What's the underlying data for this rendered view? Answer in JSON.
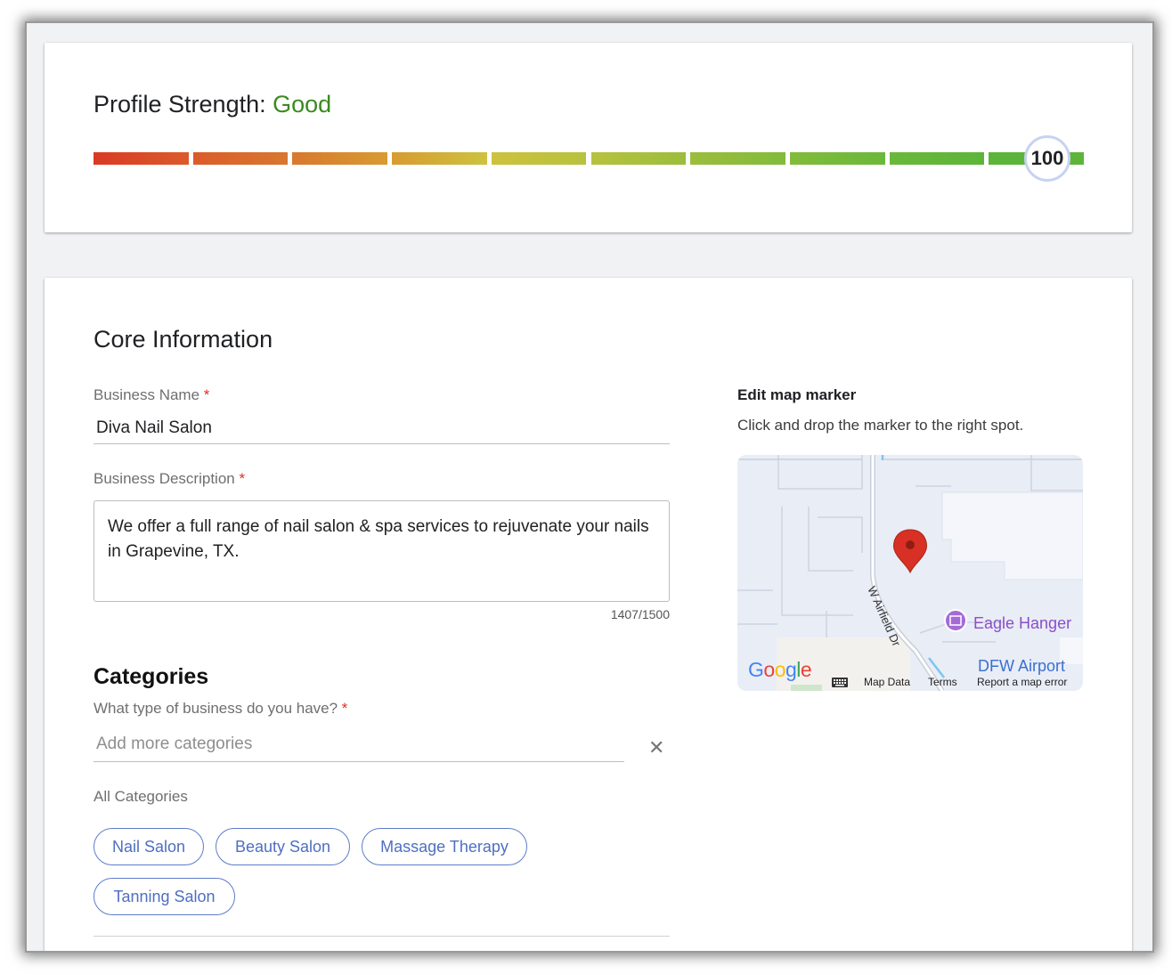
{
  "strength": {
    "label": "Profile Strength:",
    "level": "Good",
    "score": "100",
    "segments": 10,
    "segment_colors": [
      "#d93a24",
      "#db5b2b",
      "#d8782f",
      "#d89b32",
      "#cdc23f",
      "#b7c23e",
      "#9cbd3d",
      "#82bb3c",
      "#6ab83b",
      "#5cb53a"
    ]
  },
  "core": {
    "title": "Core Information",
    "business_name": {
      "label": "Business Name",
      "required": "*",
      "value": "Diva Nail Salon"
    },
    "business_description": {
      "label": "Business Description",
      "required": "*",
      "value": "We offer a full range of nail salon & spa services to rejuvenate your nails in Grapevine, TX.",
      "counter": "1407/1500"
    }
  },
  "categories": {
    "title": "Categories",
    "question": "What type of business do you have?",
    "required": "*",
    "placeholder": "Add more categories",
    "clear_icon": "close-icon",
    "all_label": "All Categories",
    "chips": [
      "Nail Salon",
      "Beauty Salon",
      "Massage Therapy",
      "Tanning Salon"
    ]
  },
  "map": {
    "title": "Edit map marker",
    "subtitle": "Click and drop the marker to the right spot.",
    "street_label": "W Airfield Dr",
    "poi_label": "Eagle Hanger",
    "airport_label": "DFW Airport",
    "logo": "Google",
    "footer": {
      "keyboard_icon": "keyboard-icon",
      "map_data": "Map Data",
      "terms": "Terms",
      "report": "Report a map error"
    },
    "marker_icon": "map-pin-icon",
    "colors": {
      "marker": "#d93025",
      "poi": "#a56ad8",
      "airport_text": "#3b6fd0",
      "background": "#e9edf6"
    }
  }
}
